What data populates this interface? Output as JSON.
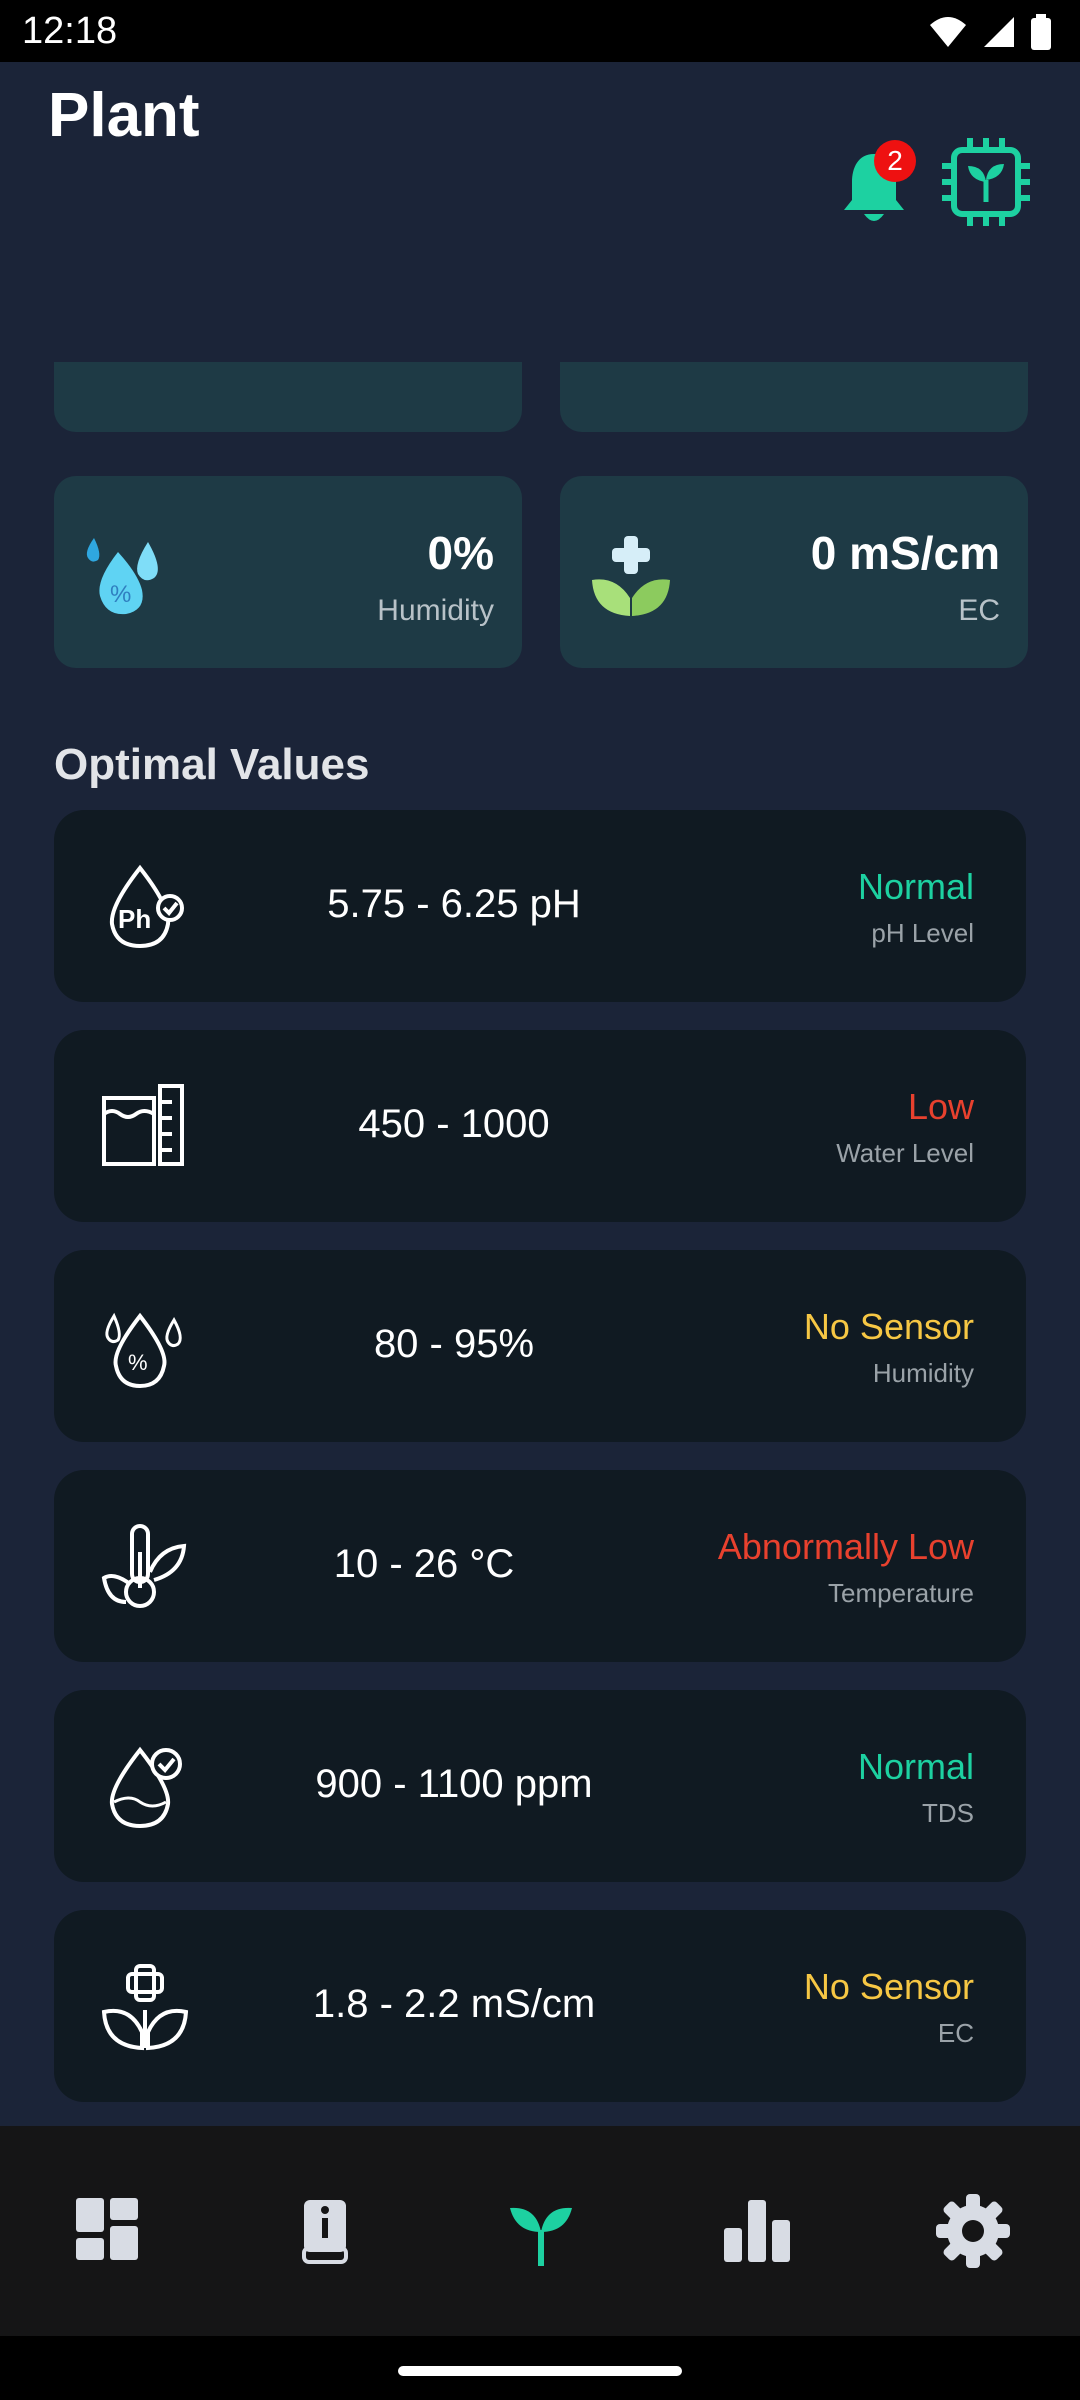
{
  "status_bar": {
    "time": "12:18"
  },
  "header": {
    "title": "Plant",
    "notification_count": "2"
  },
  "sensors": [
    {
      "value": "0%",
      "label": "Humidity",
      "icon": "humidity-drops-icon"
    },
    {
      "value": "0 mS/cm",
      "label": "EC",
      "icon": "ec-leaf-icon"
    }
  ],
  "optimal": {
    "title": "Optimal Values",
    "items": [
      {
        "range": "5.75 - 6.25 pH",
        "status": "Normal",
        "status_color": "#1DD1A1",
        "label": "pH Level",
        "icon": "ph-drop-icon"
      },
      {
        "range": "450 - 1000",
        "status": "Low",
        "status_color": "#E8412E",
        "label": "Water Level",
        "icon": "water-level-icon"
      },
      {
        "range": "80 - 95%",
        "status": "No Sensor",
        "status_color": "#F6C744",
        "label": "Humidity",
        "icon": "humidity-icon"
      },
      {
        "range": "10 - 26 °C",
        "status": "Abnormally Low",
        "status_color": "#E8412E",
        "label": "Temperature",
        "icon": "thermometer-leaf-icon"
      },
      {
        "range": "900 - 1100 ppm",
        "status": "Normal",
        "status_color": "#1DD1A1",
        "label": "TDS",
        "icon": "tds-drop-icon"
      },
      {
        "range": "1.8 - 2.2 mS/cm",
        "status": "No Sensor",
        "status_color": "#F6C744",
        "label": "EC",
        "icon": "ec-plant-icon"
      }
    ]
  },
  "colors": {
    "accent": "#1DD1A1",
    "background": "#1B2438",
    "card": "#101A22",
    "sensor_card": "#1E3A45"
  },
  "nav": [
    "dashboard-icon",
    "guide-book-icon",
    "plant-icon",
    "stats-icon",
    "settings-gear-icon"
  ]
}
